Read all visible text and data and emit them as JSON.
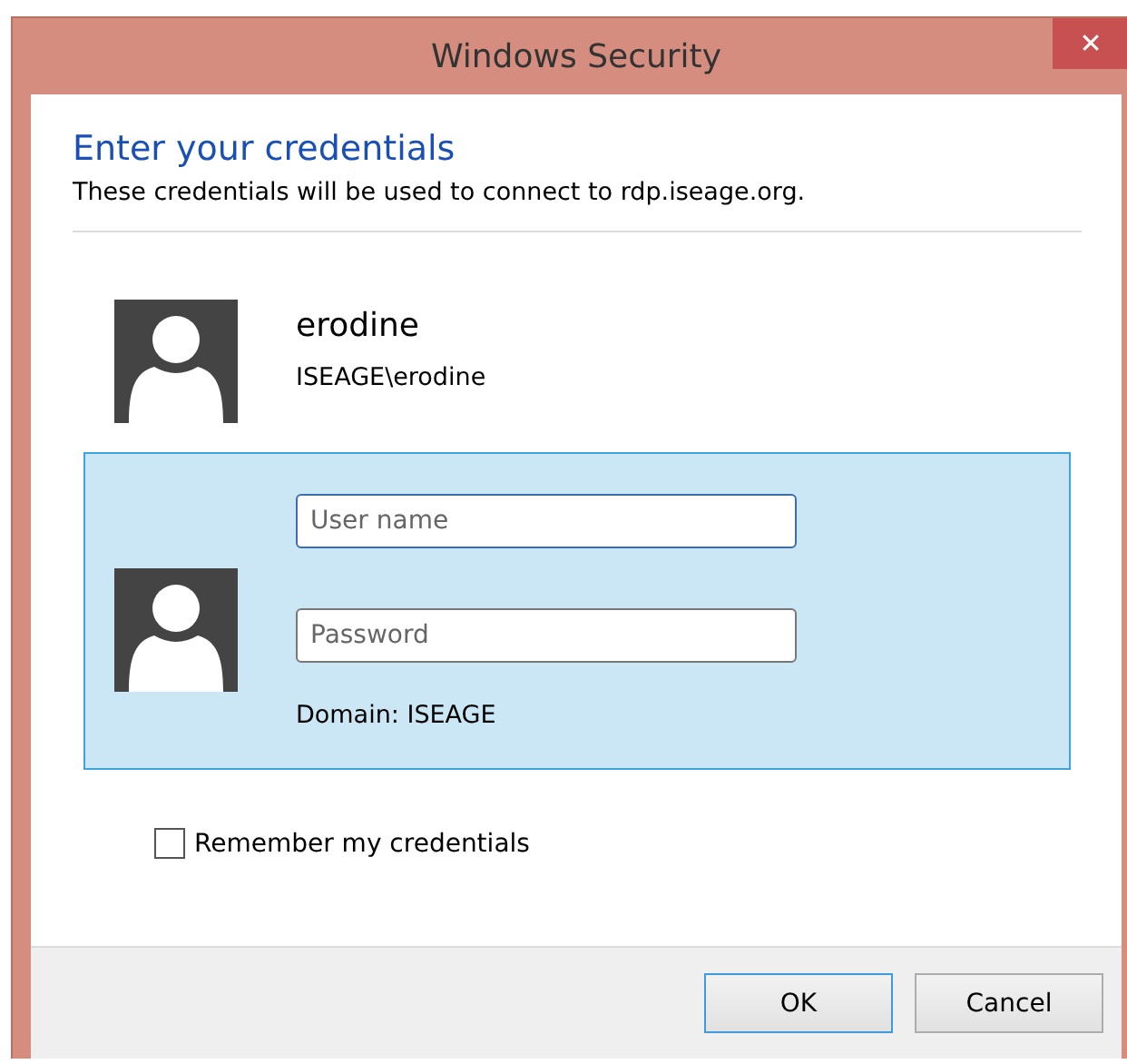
{
  "window": {
    "title": "Windows Security",
    "close": "✕"
  },
  "heading": "Enter your credentials",
  "description": "These credentials will be used to connect to rdp.iseage.org.",
  "accounts": [
    {
      "kind": "saved",
      "selected": false,
      "name": "erodine",
      "account": "ISEAGE\\erodine"
    },
    {
      "kind": "new",
      "selected": true,
      "fields": [
        {
          "placeholder": "User name",
          "focused": true
        },
        {
          "placeholder": "Password",
          "focused": false
        }
      ],
      "domain": "Domain: ISEAGE"
    }
  ],
  "remember": {
    "label": "Remember my credentials",
    "checked": false
  },
  "buttons": [
    {
      "label": "OK",
      "default": true
    },
    {
      "label": "Cancel",
      "default": false
    }
  ]
}
